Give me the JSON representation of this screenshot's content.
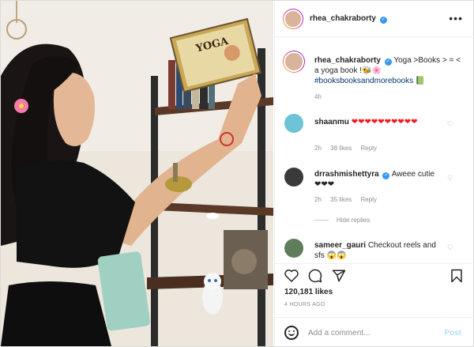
{
  "photo": {
    "book_title": "YOGA"
  },
  "header": {
    "username": "rhea_chakraborty",
    "verified_mark": "✓",
    "more": "•••"
  },
  "caption": {
    "username": "rhea_chakraborty",
    "text": "Yoga >Books > = < a yoga book !🐝🌸",
    "hashtag": "#booksbooksandmorebooks",
    "hashtag_emoji": "📗",
    "time": "4h"
  },
  "comments": [
    {
      "username": "shaanmu",
      "text": "❤❤❤❤❤❤❤❤❤❤",
      "time": "2h",
      "likes": "38 likes",
      "reply": "Reply"
    },
    {
      "username": "drrashmishettyra",
      "text": "Aweee cutie ❤❤❤",
      "time": "2h",
      "likes": "35 likes",
      "reply": "Reply"
    },
    {
      "username": "sameer_gauri",
      "text": "Checkout reels and sfs 😱😱"
    }
  ],
  "hide_replies": "Hide replies",
  "actions": {
    "likes": "120,181 likes",
    "posted_ago": "4 HOURS AGO"
  },
  "add_comment": {
    "placeholder": "Add a comment...",
    "post_label": "Post"
  },
  "colors": {
    "accent": "#3897f0",
    "heart": "#ed1c24",
    "muted": "#8e8e8e",
    "border": "#dbdbdb"
  }
}
